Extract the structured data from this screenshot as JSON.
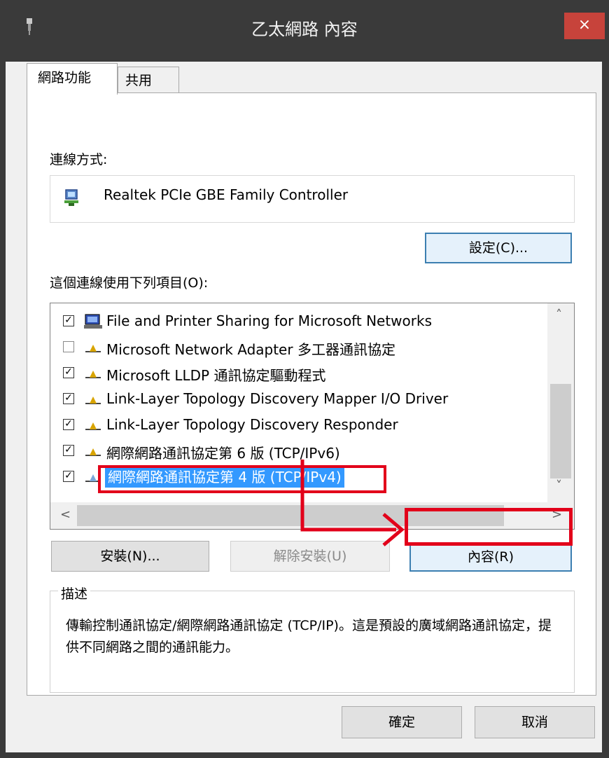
{
  "window": {
    "title": "乙太網路 內容",
    "close_label": "×"
  },
  "tabs": [
    {
      "label": "網路功能"
    },
    {
      "label": "共用"
    }
  ],
  "connect_using": {
    "label": "連線方式:",
    "adapter_name": "Realtek PCIe GBE Family Controller",
    "configure_label": "設定(C)..."
  },
  "items_label": "這個連線使用下列項目(O):",
  "items": [
    {
      "label": "File and Printer Sharing for Microsoft Networks",
      "checked": true
    },
    {
      "label": "Microsoft Network Adapter 多工器通訊協定",
      "checked": false
    },
    {
      "label": "Microsoft LLDP 通訊協定驅動程式",
      "checked": true
    },
    {
      "label": "Link-Layer Topology Discovery Mapper I/O Driver",
      "checked": true
    },
    {
      "label": "Link-Layer Topology Discovery Responder",
      "checked": true
    },
    {
      "label": "網際網路通訊協定第 6 版 (TCP/IPv6)",
      "checked": true
    },
    {
      "label": "網際網路通訊協定第 4 版 (TCP/IPv4)",
      "checked": true,
      "selected": true
    }
  ],
  "buttons": {
    "install": "安裝(N)...",
    "uninstall": "解除安裝(U)",
    "properties": "內容(R)",
    "ok": "確定",
    "cancel": "取消"
  },
  "description": {
    "title": "描述",
    "text": "傳輸控制通訊協定/網際網路通訊協定 (TCP/IP)。這是預設的廣域網路通訊協定，提供不同網路之間的通訊能力。"
  },
  "colors": {
    "highlight": "#e2001a",
    "selection": "#3399ff",
    "close_button": "#c7433b"
  }
}
